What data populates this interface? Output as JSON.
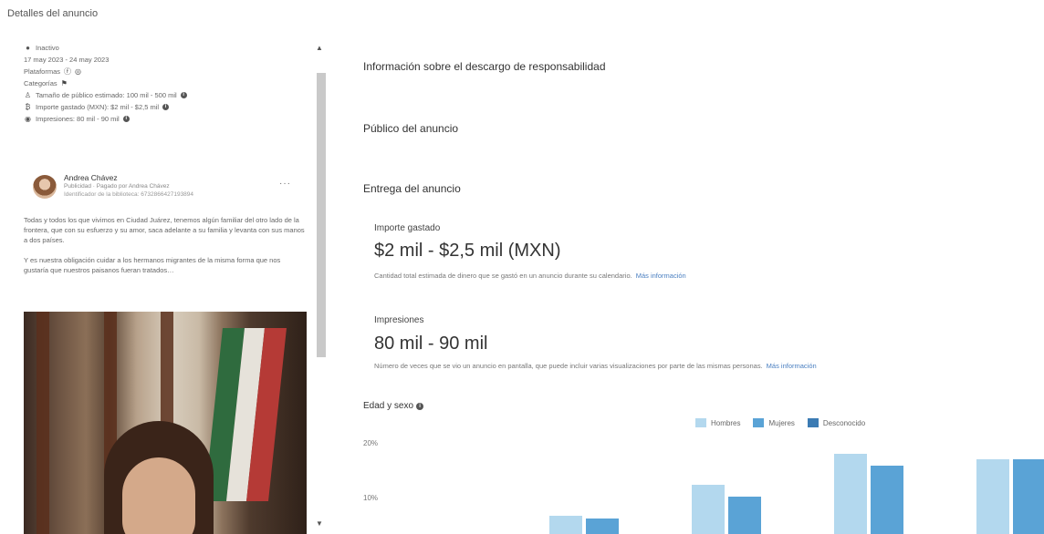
{
  "page_title": "Detalles del anuncio",
  "ad_meta": {
    "status": "Inactivo",
    "dates": "17 may 2023 - 24 may 2023",
    "platforms_label": "Plataformas",
    "categories_label": "Categorías",
    "audience": "Tamaño de público estimado: 100 mil - 500 mil",
    "spend": "Importe gastado (MXN): $2 mil - $2,5 mil",
    "impressions": "Impresiones: 80 mil - 90 mil"
  },
  "post": {
    "author": "Andrea Chávez",
    "sponsor": "Publicidad · Pagado por Andrea Chávez",
    "library_id": "Identificador de la biblioteca: 6732866427193894",
    "paragraphs": [
      "Todas y todos los que vivimos en Ciudad Juárez, tenemos algún familiar del otro lado de la frontera, que con su esfuerzo y su amor, saca adelante a su familia y levanta con sus manos a dos países.",
      "Y es nuestra obligación cuidar a los hermanos migrantes de la misma forma que nos gustaría que nuestros paisanos fueran tratados…"
    ],
    "more_icon": "ellipsis-icon"
  },
  "sections": {
    "disclaimer": "Información sobre el descargo de responsabilidad",
    "audience": "Público del anuncio",
    "delivery": "Entrega del anuncio"
  },
  "spend": {
    "label": "Importe gastado",
    "value": "$2 mil - $2,5 mil (MXN)",
    "desc": "Cantidad total estimada de dinero que se gastó en un anuncio durante su calendario.",
    "link": "Más información"
  },
  "impressions": {
    "label": "Impresiones",
    "value": "80 mil - 90 mil",
    "desc": "Número de veces que se vio un anuncio en pantalla, que puede incluir varias visualizaciones por parte de las mismas personas.",
    "link": "Más información"
  },
  "chart_title": "Edad y sexo",
  "colors": {
    "hombres": "#b3d8ee",
    "mujeres": "#5aa3d6",
    "desconocido": "#3b7bb3",
    "link": "#4a7fc1"
  },
  "chart_data": {
    "type": "bar",
    "title": "Edad y sexo",
    "series": [
      {
        "name": "Hombres",
        "values": [
          3,
          8,
          13,
          12
        ]
      },
      {
        "name": "Mujeres",
        "values": [
          2.5,
          6,
          11,
          12
        ]
      }
    ],
    "yticks": [
      "20%",
      "10%"
    ],
    "ylim": [
      0,
      20
    ],
    "legend": [
      "Hombres",
      "Mujeres",
      "Desconocido"
    ],
    "legend_position": "top-right"
  }
}
